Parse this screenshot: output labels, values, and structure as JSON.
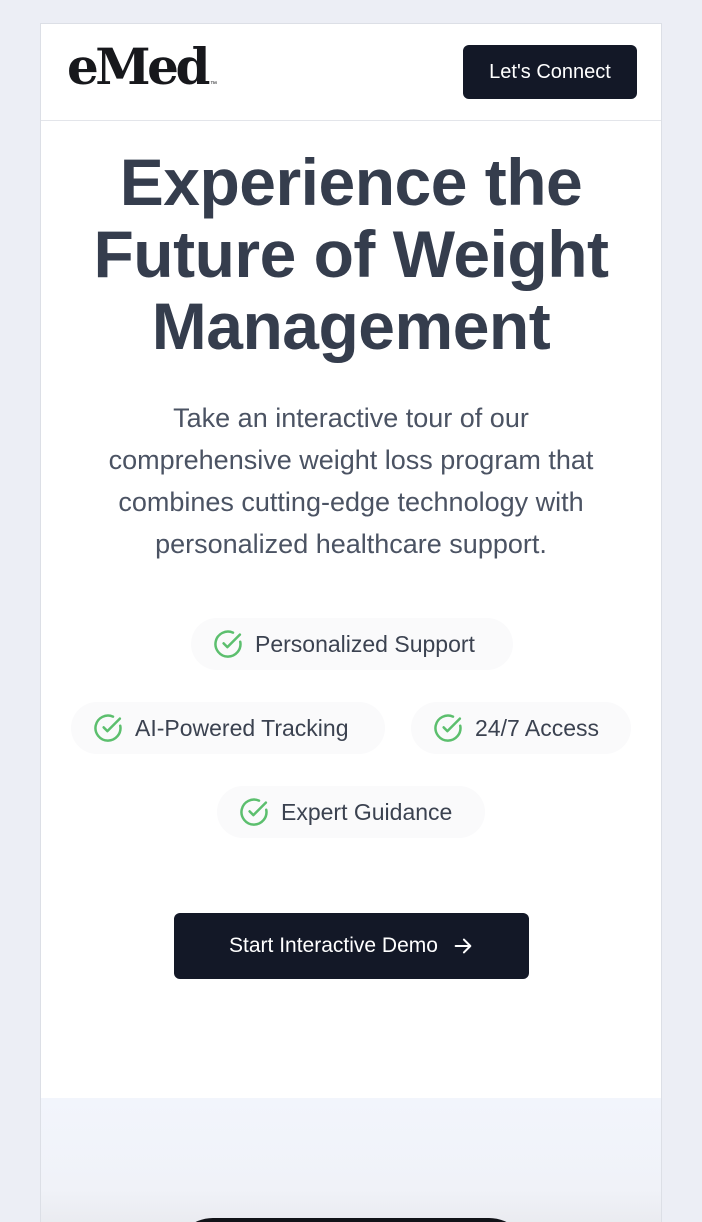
{
  "header": {
    "logo_text": "eMed",
    "logo_tm": "™",
    "connect_label": "Let's Connect"
  },
  "hero": {
    "title_lines": [
      "Experience the",
      "Future of Weight",
      "Management"
    ],
    "subtitle_lines": [
      "Take an interactive tour of our",
      "comprehensive weight loss program that",
      "combines cutting-edge technology with",
      "personalized healthcare support."
    ]
  },
  "features": [
    {
      "label": "Personalized Support",
      "icon": "check-circle-icon"
    },
    {
      "label": "AI-Powered Tracking",
      "icon": "check-circle-icon"
    },
    {
      "label": "24/7 Access",
      "icon": "check-circle-icon"
    },
    {
      "label": "Expert Guidance",
      "icon": "check-circle-icon"
    }
  ],
  "cta": {
    "label": "Start Interactive Demo",
    "icon": "arrow-right-icon"
  },
  "colors": {
    "accent_dark": "#131827",
    "check_green": "#5cbf6e",
    "heading": "#353d4d",
    "body_text": "#4b5363"
  }
}
